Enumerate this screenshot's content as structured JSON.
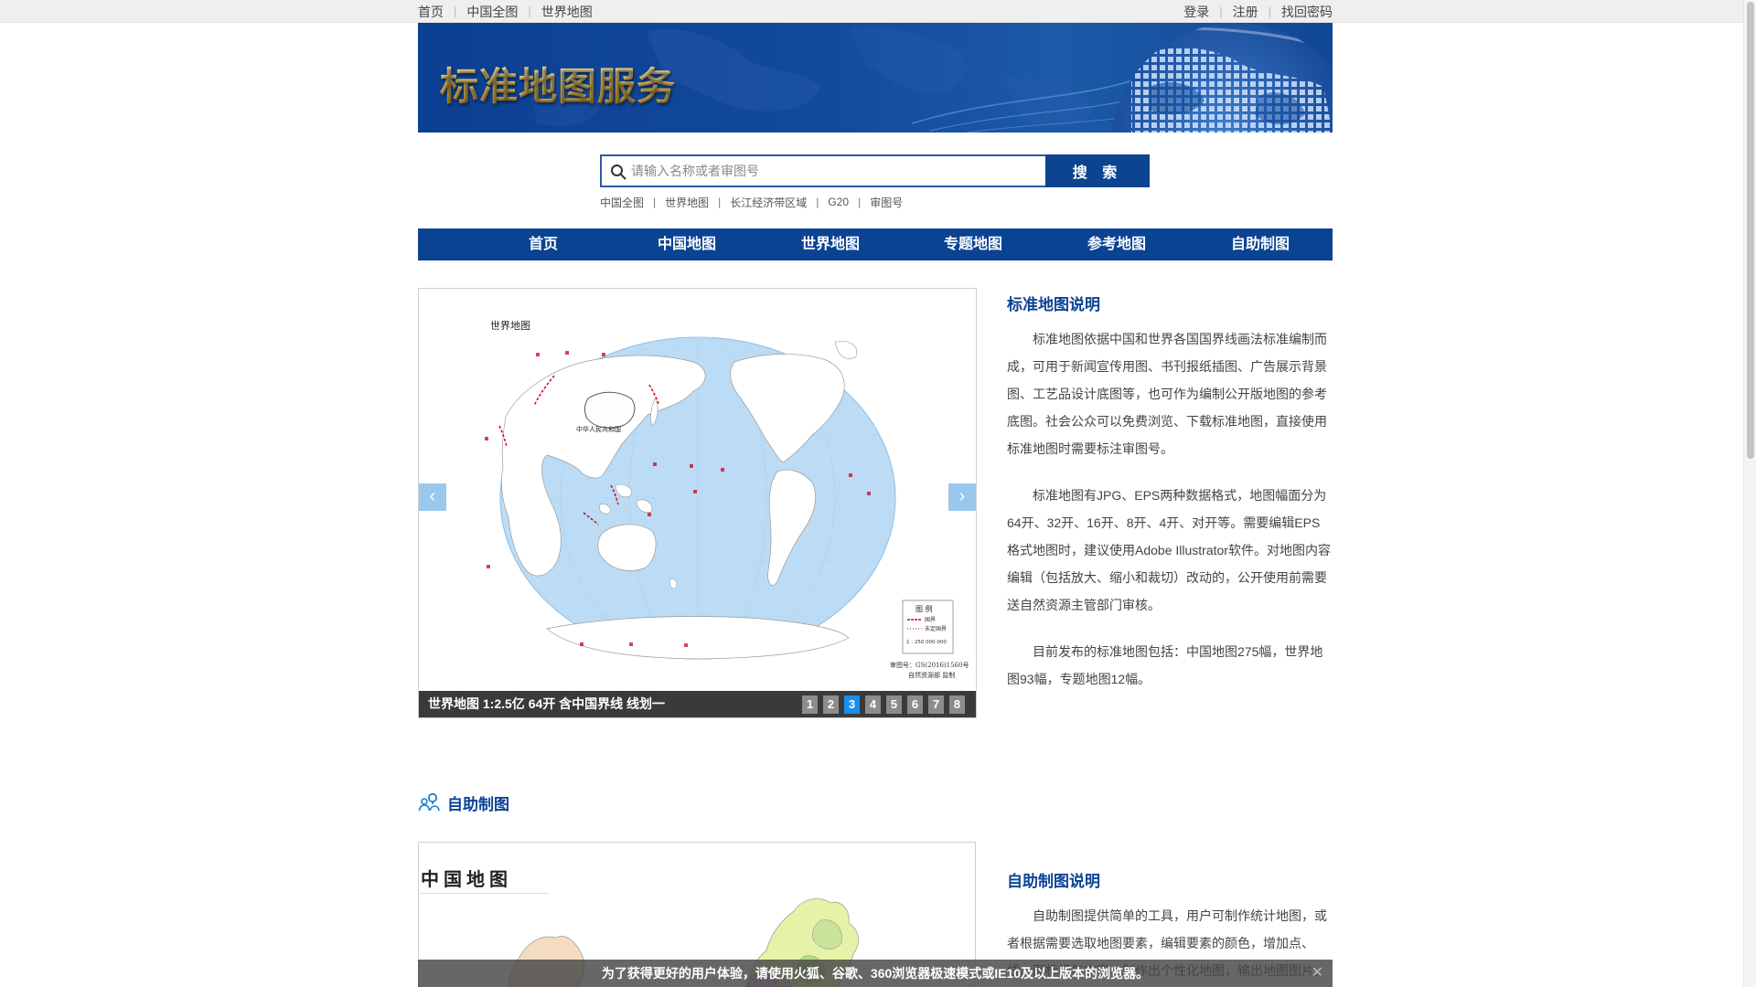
{
  "topbar": {
    "left_links": [
      "首页",
      "中国全图",
      "世界地图"
    ],
    "right_links": [
      "登录",
      "注册",
      "找回密码"
    ]
  },
  "banner": {
    "title": "标准地图服务"
  },
  "search": {
    "placeholder": "请输入名称或者审图号",
    "button_label": "搜 索",
    "quick_links": [
      "中国全图",
      "世界地图",
      "长江经济带区域",
      "G20",
      "审图号"
    ]
  },
  "nav": {
    "items": [
      "首页",
      "中国地图",
      "世界地图",
      "专题地图",
      "参考地图",
      "自助制图"
    ]
  },
  "carousel": {
    "map_title": "世界地图",
    "map_country_label": "中华人民共和国",
    "legend_title": "图 例",
    "legend_items": [
      "国界",
      "未定国界"
    ],
    "legend_scale": "1 : 250 000 000",
    "map_footer": [
      "审图号：GS(2016)1560号",
      "自然资源部 监制"
    ],
    "caption": "世界地图 1:2.5亿 64开 含中国界线 线划一",
    "pages": [
      "1",
      "2",
      "3",
      "4",
      "5",
      "6",
      "7",
      "8"
    ],
    "active_page": "3",
    "prev_icon": "chevron-left-icon",
    "next_icon": "chevron-right-icon"
  },
  "standard_map_desc": {
    "title": "标准地图说明",
    "paragraphs": [
      "标准地图依据中国和世界各国国界线画法标准编制而成，可用于新闻宣传用图、书刊报纸插图、广告展示背景图、工艺品设计底图等，也可作为编制公开版地图的参考底图。社会公众可以免费浏览、下载标准地图，直接使用标准地图时需要标注审图号。",
      "标准地图有JPG、EPS两种数据格式，地图幅面分为64开、32开、16开、8开、4开、对开等。需要编辑EPS格式地图时，建议使用Adobe Illustrator软件。对地图内容编辑（包括放大、缩小和裁切）改动的，公开使用前需要送自然资源主管部门审核。",
      "目前发布的标准地图包括：中国地图275幅，世界地图93幅，专题地图12幅。"
    ]
  },
  "self_mapping": {
    "section_title": "自助制图",
    "section_icon": "map-pin-users-icon",
    "china_map_title": "中国地图",
    "desc_title": "自助制图说明",
    "desc_paragraph": "自助制图提供简单的工具，用户可制作统计地图，或者根据需要选取地图要素，编辑要素的颜色，增加点、线、面标记与文字，制作出个性化地图，输出地图图片。"
  },
  "notice": {
    "text": "为了获得更好的用户体验，请使用火狐、谷歌、360浏览器极速模式或IE10及以上版本的浏览器。",
    "close_icon": "close-icon"
  },
  "colors": {
    "brand_blue": "#0b4393",
    "ocean": "#bcdcf5",
    "land": "#ffffff",
    "border_red": "#d0021b",
    "active_page": "#1a8ee8"
  }
}
